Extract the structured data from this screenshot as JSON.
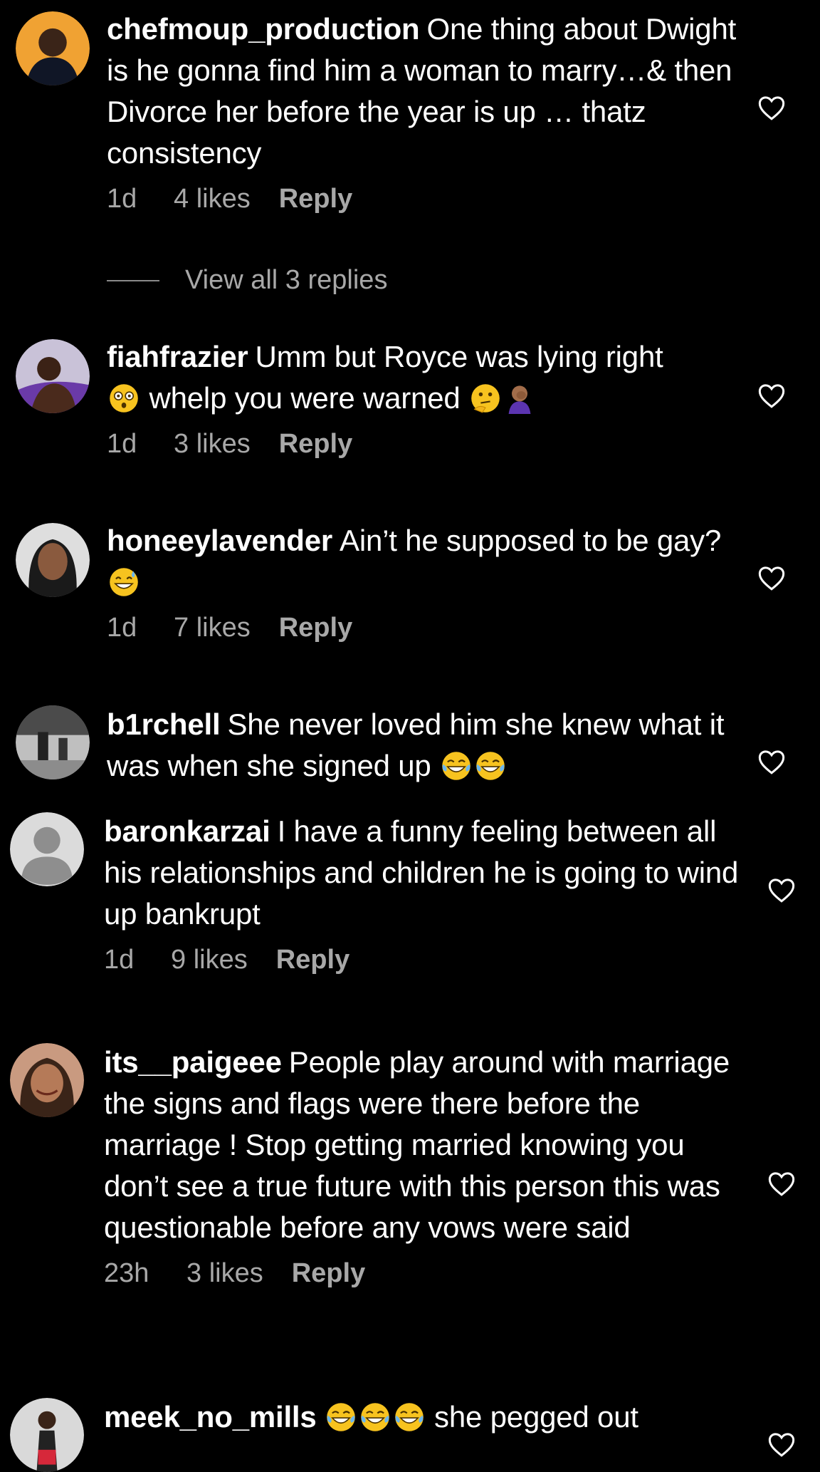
{
  "comments": [
    {
      "username": "chefmoup_production",
      "text": "One thing about Dwight is he gonna find him a woman to marry…& then Divorce her before the year is up … thatz consistency",
      "time": "1d",
      "likes": "4 likes",
      "reply": "Reply"
    },
    {
      "username": "fiahfrazier",
      "text_before": "Umm but Royce was lying right",
      "text_after": "whelp you were warned",
      "emojis": [
        "face-with-spiral-eyes-emoji",
        "thinking-face-emoji",
        "person-facepalming-emoji"
      ],
      "time": "1d",
      "likes": "3 likes",
      "reply": "Reply"
    },
    {
      "username": "honeeylavender",
      "text": "Ain’t he supposed to be gay?",
      "emojis": [
        "grinning-face-with-sweat-emoji"
      ],
      "time": "1d",
      "likes": "7 likes",
      "reply": "Reply"
    },
    {
      "username": "b1rchell",
      "text": "She never loved him she knew what it was when she signed up",
      "emojis": [
        "tears-of-joy-emoji",
        "tears-of-joy-emoji"
      ]
    },
    {
      "username": "baronkarzai",
      "text": "I have a funny feeling between all his relationships and children he is going to wind up bankrupt",
      "time": "1d",
      "likes": "9 likes",
      "reply": "Reply"
    },
    {
      "username": "its__paigeee",
      "text": "People play around with marriage the signs and flags were there before the marriage ! Stop getting married knowing you don’t see a true future with this person this was questionable before any vows were said",
      "time": "23h",
      "likes": "3 likes",
      "reply": "Reply"
    },
    {
      "username": "meek_no_mills",
      "emojis": [
        "tears-of-joy-emoji",
        "tears-of-joy-emoji",
        "tears-of-joy-emoji"
      ],
      "text": "she pegged out"
    }
  ],
  "view_replies": "View all 3 replies",
  "colors": {
    "background": "#000000",
    "text": "#ffffff",
    "secondary": "#a8a8a8"
  }
}
